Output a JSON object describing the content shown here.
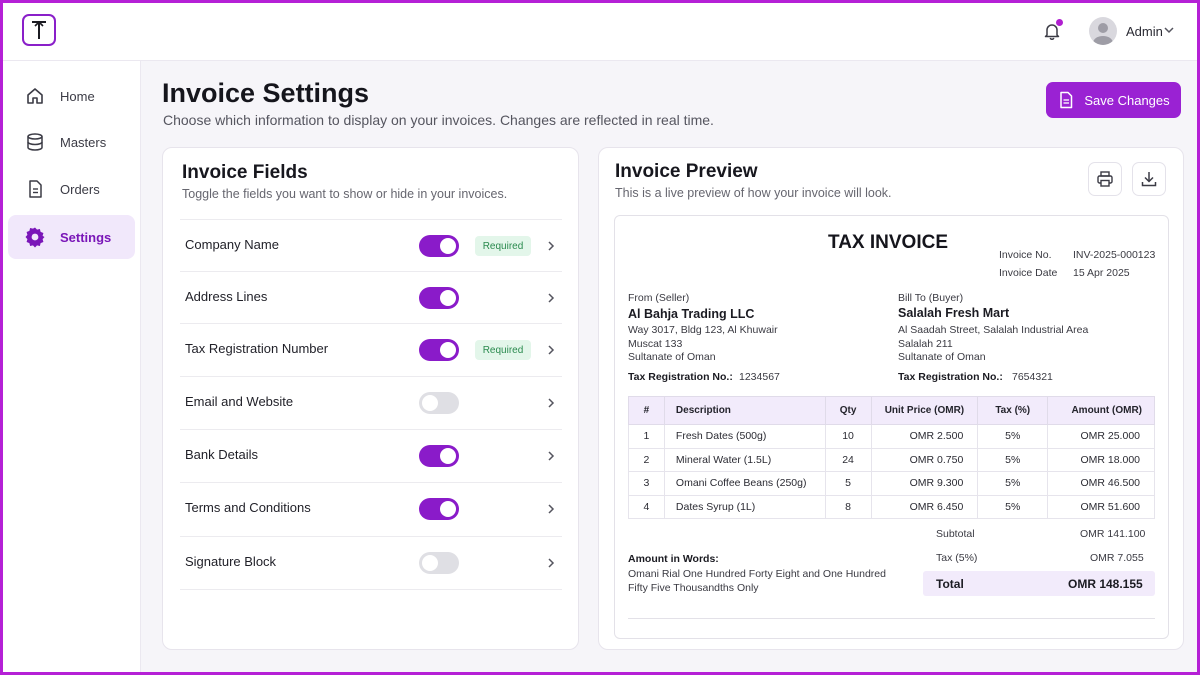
{
  "header": {
    "user_name": "Admin"
  },
  "sidebar": {
    "items": [
      {
        "label": "Home",
        "icon": "home-icon"
      },
      {
        "label": "Masters",
        "icon": "database-icon"
      },
      {
        "label": "Orders",
        "icon": "document-icon"
      },
      {
        "label": "Settings",
        "icon": "gear-icon",
        "active": true
      }
    ]
  },
  "page": {
    "title": "Invoice Settings",
    "subtitle": "Choose which information to display on your invoices. Changes are reflected in real time.",
    "save_label": "Save Changes"
  },
  "fields_card": {
    "title": "Invoice Fields",
    "subtitle": "Toggle the fields you want to show or hide in your invoices.",
    "fields": [
      {
        "label": "Company Name",
        "enabled": true,
        "badge": "Required"
      },
      {
        "label": "Address Lines",
        "enabled": true,
        "badge": ""
      },
      {
        "label": "Tax Registration Number",
        "enabled": true,
        "badge": "Required"
      },
      {
        "label": "Email and Website",
        "enabled": false,
        "badge": ""
      },
      {
        "label": "Bank Details",
        "enabled": true,
        "badge": ""
      },
      {
        "label": "Terms and Conditions",
        "enabled": true,
        "badge": ""
      },
      {
        "label": "Signature Block",
        "enabled": false,
        "badge": ""
      }
    ]
  },
  "preview_card": {
    "title": "Invoice Preview",
    "subtitle": "This is a live preview of how your invoice will look."
  },
  "invoice": {
    "heading": "TAX INVOICE",
    "number_label": "Invoice No.",
    "number": "INV-2025-000123",
    "date_label": "Invoice Date",
    "date": "15 Apr 2025",
    "seller": {
      "caption": "From (Seller)",
      "name": "Al Bahja Trading LLC",
      "line1": "Way 3017, Bldg 123, Al Khuwair",
      "line2": "Muscat 133",
      "line3": "Sultanate of Oman",
      "trn_label": "Tax Registration No.:",
      "trn": "1234567"
    },
    "buyer": {
      "caption": "Bill To (Buyer)",
      "name": "Salalah Fresh Mart",
      "line1": "Al Saadah Street, Salalah Industrial Area",
      "line2": "Salalah 211",
      "line3": "Sultanate of Oman",
      "trn_label": "Tax Registration No.:",
      "trn": "7654321"
    },
    "columns": [
      "#",
      "Description",
      "Qty",
      "Unit Price (OMR)",
      "Tax (%)",
      "Amount (OMR)"
    ],
    "rows": [
      {
        "no": "1",
        "desc": "Fresh Dates (500g)",
        "qty": "10",
        "unit": "OMR 2.500",
        "tax": "5%",
        "amount": "OMR 25.000"
      },
      {
        "no": "2",
        "desc": "Mineral Water (1.5L)",
        "qty": "24",
        "unit": "OMR 0.750",
        "tax": "5%",
        "amount": "OMR 18.000"
      },
      {
        "no": "3",
        "desc": "Omani Coffee Beans (250g)",
        "qty": "5",
        "unit": "OMR 9.300",
        "tax": "5%",
        "amount": "OMR 46.500"
      },
      {
        "no": "4",
        "desc": "Dates Syrup (1L)",
        "qty": "8",
        "unit": "OMR 6.450",
        "tax": "5%",
        "amount": "OMR 51.600"
      }
    ],
    "subtotal_label": "Subtotal",
    "subtotal": "OMR 141.100",
    "tax_label": "Tax (5%)",
    "tax": "OMR 7.055",
    "total_label": "Total",
    "total": "OMR 148.155",
    "words_label": "Amount in Words:",
    "words_line1": "Omani Rial One Hundred Forty Eight and One Hundred",
    "words_line2": "Fifty Five Thousandths Only"
  },
  "colors": {
    "accent": "#9a22d3",
    "accent_light": "#f1e8fb",
    "required_bg": "#e3f6ea",
    "required_text": "#2a8a4e"
  }
}
